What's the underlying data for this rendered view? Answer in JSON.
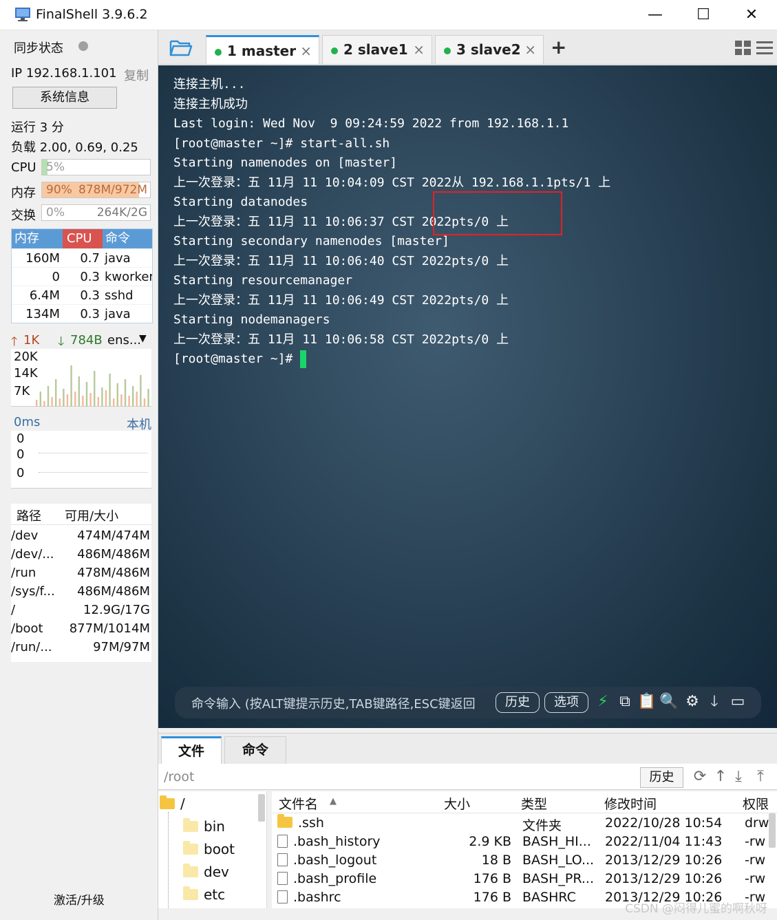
{
  "window": {
    "title": "FinalShell 3.9.6.2",
    "minimize": "—",
    "maximize": "☐",
    "close": "✕"
  },
  "sidebar": {
    "sync_label": "同步状态",
    "ip_label": "IP 192.168.1.101",
    "copy_label": "复制",
    "sysinfo_button": "系统信息",
    "uptime": "运行 3 分",
    "load": "负载 2.00, 0.69, 0.25",
    "cpu": {
      "label": "CPU",
      "value": "5%",
      "fraction": 0.05
    },
    "mem": {
      "label": "内存",
      "value": "90%",
      "detail": "878M/972M",
      "fraction": 0.9
    },
    "swap": {
      "label": "交换",
      "value": "0%",
      "detail": "264K/2G",
      "fraction": 0.0
    },
    "proc_headers": {
      "mem": "内存",
      "cpu": "CPU",
      "cmd": "命令"
    },
    "processes": [
      {
        "mem": "160M",
        "cpu": "0.7",
        "cmd": "java"
      },
      {
        "mem": "0",
        "cpu": "0.3",
        "cmd": "kworker/"
      },
      {
        "mem": "6.4M",
        "cpu": "0.3",
        "cmd": "sshd"
      },
      {
        "mem": "134M",
        "cpu": "0.3",
        "cmd": "java"
      }
    ],
    "net": {
      "up": "1K",
      "down": "784B",
      "iface": "ens...",
      "scale": [
        "20K",
        "14K",
        "7K"
      ]
    },
    "ping": {
      "latency": "0ms",
      "target": "本机",
      "values": [
        "0",
        "0",
        "0"
      ]
    },
    "disk_headers": {
      "path": "路径",
      "size": "可用/大小"
    },
    "disks": [
      {
        "path": "/dev",
        "size": "474M/474M"
      },
      {
        "path": "/dev/...",
        "size": "486M/486M"
      },
      {
        "path": "/run",
        "size": "478M/486M"
      },
      {
        "path": "/sys/f...",
        "size": "486M/486M"
      },
      {
        "path": "/",
        "size": "12.9G/17G"
      },
      {
        "path": "/boot",
        "size": "877M/1014M"
      },
      {
        "path": "/run/...",
        "size": "97M/97M"
      }
    ],
    "activate": "激活/升级"
  },
  "tabs": [
    {
      "label": "1 master",
      "active": true
    },
    {
      "label": "2 slave1",
      "active": false
    },
    {
      "label": "3 slave2",
      "active": false
    }
  ],
  "tab_add": "+",
  "tab_close": "×",
  "terminal": {
    "lines": [
      "连接主机...",
      "连接主机成功",
      "Last login: Wed Nov  9 09:24:59 2022 from 192.168.1.1",
      "[root@master ~]# start-all.sh",
      "Starting namenodes on [master]",
      "上一次登录：五 11月 11 10:04:09 CST 2022从 192.168.1.1pts/1 上",
      "Starting datanodes",
      "上一次登录：五 11月 11 10:06:37 CST 2022pts/0 上",
      "Starting secondary namenodes [master]",
      "上一次登录：五 11月 11 10:06:40 CST 2022pts/0 上",
      "Starting resourcemanager",
      "上一次登录：五 11月 11 10:06:49 CST 2022pts/0 上",
      "Starting nodemanagers",
      "上一次登录：五 11月 11 10:06:58 CST 2022pts/0 上"
    ],
    "prompt": "[root@master ~]# "
  },
  "cmdbar": {
    "placeholder": "命令输入 (按ALT键提示历史,TAB键路径,ESC键返回",
    "history": "历史",
    "options": "选项"
  },
  "bottom": {
    "tabs": [
      "文件",
      "命令"
    ],
    "path": "/root",
    "history": "历史",
    "tree": [
      {
        "name": "/"
      },
      {
        "name": "bin"
      },
      {
        "name": "boot"
      },
      {
        "name": "dev"
      },
      {
        "name": "etc"
      }
    ],
    "file_headers": {
      "name": "文件名",
      "size": "大小",
      "type": "类型",
      "mtime": "修改时间",
      "perm": "权限"
    },
    "files": [
      {
        "name": ".ssh",
        "size": "",
        "type": "文件夹",
        "mtime": "2022/10/28 10:54",
        "perm": "drw",
        "folder": true
      },
      {
        "name": ".bash_history",
        "size": "2.9 KB",
        "type": "BASH_HI...",
        "mtime": "2022/11/04 11:43",
        "perm": "-rw",
        "folder": false
      },
      {
        "name": ".bash_logout",
        "size": "18 B",
        "type": "BASH_LO...",
        "mtime": "2013/12/29 10:26",
        "perm": "-rw",
        "folder": false
      },
      {
        "name": ".bash_profile",
        "size": "176 B",
        "type": "BASH_PR...",
        "mtime": "2013/12/29 10:26",
        "perm": "-rw",
        "folder": false
      },
      {
        "name": ".bashrc",
        "size": "176 B",
        "type": "BASHRC",
        "mtime": "2013/12/29 10:26",
        "perm": "-rw",
        "folder": false
      }
    ]
  },
  "watermark": "CSDN @闷得儿蜜的啊秋呀"
}
